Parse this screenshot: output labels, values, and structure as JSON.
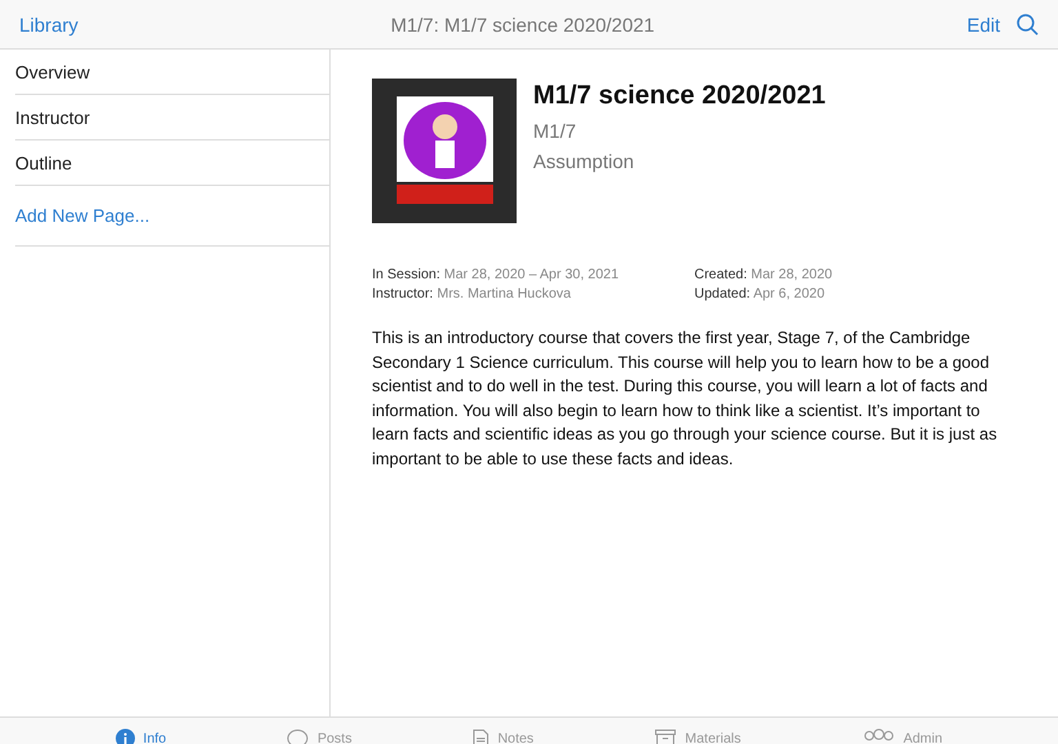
{
  "nav_bar": {
    "back": "Library",
    "title": "M1/7: M1/7 science 2020/2021",
    "edit": "Edit"
  },
  "sidebar": {
    "items": [
      {
        "label": "Overview",
        "selected": false
      },
      {
        "label": "Instructor",
        "selected": false
      },
      {
        "label": "Outline",
        "selected": false
      }
    ],
    "add_page": "Add New Page..."
  },
  "course": {
    "title": "M1/7 science 2020/2021",
    "code": "M1/7",
    "school": "Assumption",
    "meta": [
      {
        "label": "In Session:",
        "value": "Mar 28, 2020 – Apr 30, 2021"
      },
      {
        "label": "Created:",
        "value": "Mar 28, 2020"
      },
      {
        "label": "Instructor:",
        "value": "Mrs. Martina Huckova"
      },
      {
        "label": "Updated:",
        "value": "Apr 6, 2020"
      }
    ],
    "description": "This is an introductory course that covers the first year, Stage 7, of the Cambridge Secondary 1 Science curriculum. This course will help you to learn how to be a good scientist and to do well in the test. During this course, you will learn a lot of facts and information. You will also begin to learn how to think like a scientist. It’s important to learn facts and scientific ideas as you go through your science course. But it is just as important to be able to use these facts and ideas."
  },
  "tab_bar": [
    {
      "kind": "info",
      "label": "Info",
      "selected": true
    },
    {
      "kind": "posts",
      "label": "Posts",
      "selected": false
    },
    {
      "kind": "notes",
      "label": "Notes",
      "selected": false
    },
    {
      "kind": "materials",
      "label": "Materials",
      "selected": false
    },
    {
      "kind": "admin",
      "label": "Admin",
      "selected": false
    }
  ]
}
